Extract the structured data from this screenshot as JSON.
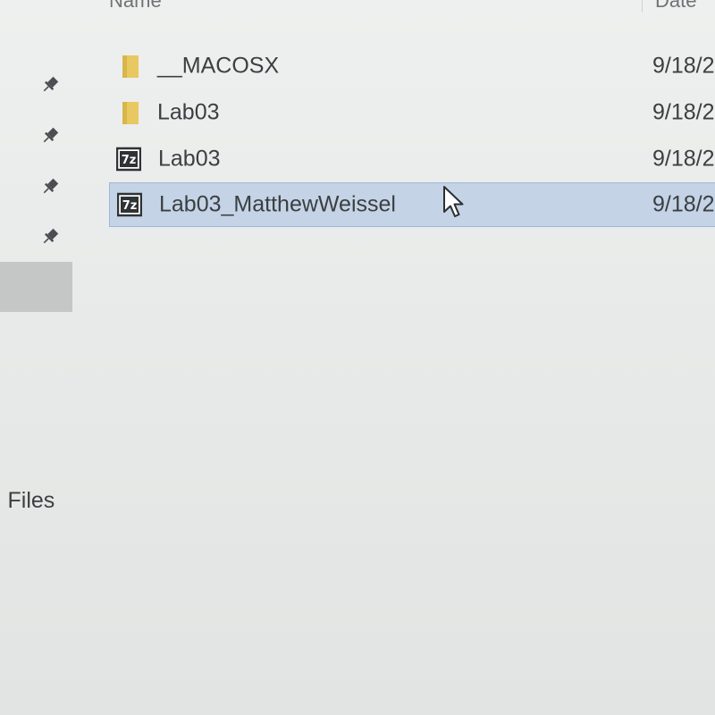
{
  "header": {
    "name_label": "Name",
    "date_label": "Date"
  },
  "nav": {
    "section_label": "l Files"
  },
  "files": [
    {
      "name": "__MACOSX",
      "date": "9/18/2",
      "icon": "folder-icon",
      "selected": false
    },
    {
      "name": "Lab03",
      "date": "9/18/2",
      "icon": "folder-icon",
      "selected": false
    },
    {
      "name": "Lab03",
      "date": "9/18/2",
      "icon": "7z-archive-icon",
      "selected": false
    },
    {
      "name": "Lab03_MatthewWeissel",
      "date": "9/18/2",
      "icon": "7z-archive-icon",
      "selected": true
    }
  ],
  "colors": {
    "selection": "#c4d3e6",
    "folder": "#e8c860"
  }
}
